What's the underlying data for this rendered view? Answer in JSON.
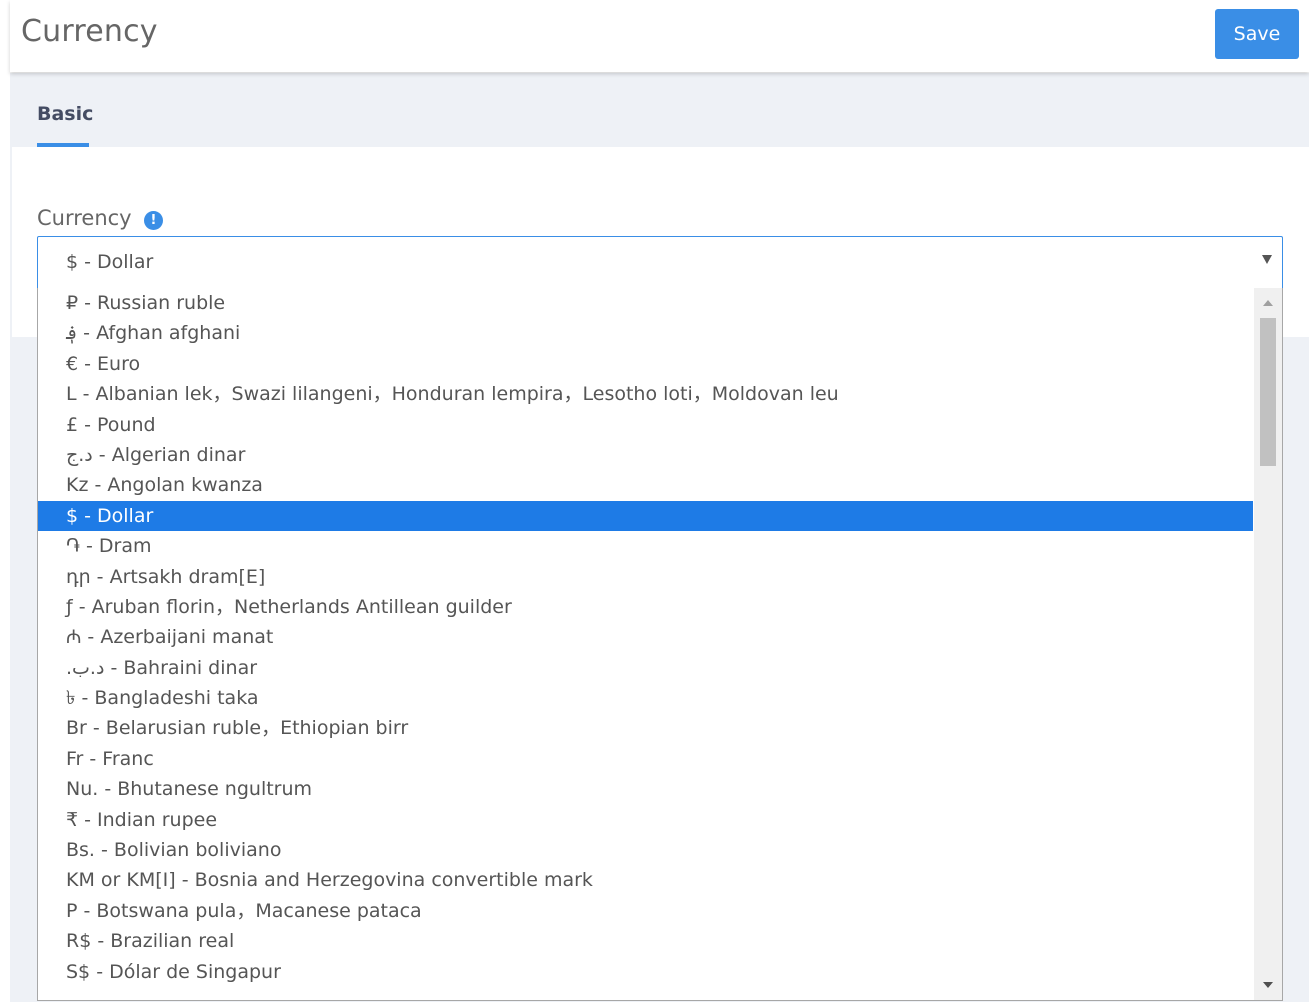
{
  "header": {
    "title": "Currency",
    "save_label": "Save"
  },
  "tabs": [
    {
      "label": "Basic",
      "active": true
    }
  ],
  "field": {
    "label": "Currency",
    "info_icon_glyph": "!",
    "selected_value": "$ - Dollar"
  },
  "dropdown": {
    "selected_index": 7,
    "options": [
      "₽ - Russian ruble",
      "؋ - Afghan afghani",
      "€ - Euro",
      "L - Albanian lek，Swazi lilangeni，Honduran lempira，Lesotho loti，Moldovan leu",
      "£ - Pound",
      "د.ج - Algerian dinar",
      "Kz - Angolan kwanza",
      "$ - Dollar",
      "֏ - Dram",
      "դր - Artsakh dram[E]",
      "ƒ - Aruban florin，Netherlands Antillean guilder",
      "₼ - Azerbaijani manat",
      ".د.ب - Bahraini dinar",
      "৳ - Bangladeshi taka",
      "Br - Belarusian ruble，Ethiopian birr",
      "Fr - Franc",
      "Nu. - Bhutanese ngultrum",
      "₹ - Indian rupee",
      "Bs. - Bolivian boliviano",
      "KM or KM[I] - Bosnia and Herzegovina convertible mark",
      "P - Botswana pula，Macanese pataca",
      "R$ - Brazilian real",
      "S$ - Dólar de Singapur"
    ]
  },
  "colors": {
    "accent": "#3a8ee6",
    "selected_row": "#1e7be6",
    "body_bg": "#eef1f6"
  },
  "icons": {
    "info": "info-icon",
    "select_arrow": "chevron-down-icon",
    "scroll_up": "scroll-up-icon",
    "scroll_down": "scroll-down-icon"
  }
}
